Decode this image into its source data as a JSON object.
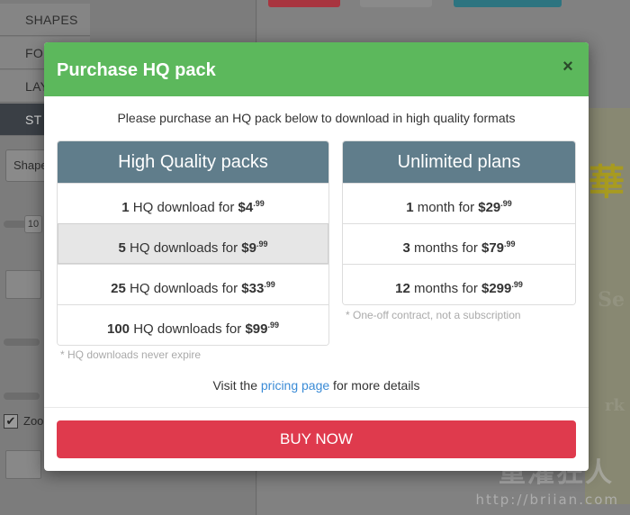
{
  "background": {
    "sidebar_tabs": [
      {
        "label": "SHAPES"
      },
      {
        "label": "FO"
      },
      {
        "label": "LAY"
      },
      {
        "label": "ST"
      }
    ],
    "shape_select": "Shape",
    "slider_value": "10",
    "zoom_label": "Zoo",
    "watermark": "http://briian.com",
    "watermark_cn": "重灌狂人",
    "colors": {
      "top_red": "#a8353f",
      "top_gray": "#8a8a8a",
      "top_teal": "#2d7480"
    }
  },
  "modal": {
    "title": "Purchase HQ pack",
    "close_icon": "×",
    "intro": "Please purchase an HQ pack below to download in high quality formats",
    "colors": {
      "header": "#5cb85c",
      "panel_head": "#607d8b",
      "buy": "#df3a4d",
      "link": "#3a8bd6"
    },
    "hq_packs": {
      "heading": "High Quality packs",
      "options": [
        {
          "qty": "1",
          "text": " HQ download for ",
          "price": "$4",
          "cents": ".99",
          "selected": false
        },
        {
          "qty": "5",
          "text": " HQ downloads for ",
          "price": "$9",
          "cents": ".99",
          "selected": true
        },
        {
          "qty": "25",
          "text": " HQ downloads for ",
          "price": "$33",
          "cents": ".99",
          "selected": false
        },
        {
          "qty": "100",
          "text": " HQ downloads for ",
          "price": "$99",
          "cents": ".99",
          "selected": false
        }
      ],
      "note": "* HQ downloads never expire"
    },
    "unlimited": {
      "heading": "Unlimited plans",
      "options": [
        {
          "qty": "1",
          "text": " month for ",
          "price": "$29",
          "cents": ".99"
        },
        {
          "qty": "3",
          "text": " months for ",
          "price": "$79",
          "cents": ".99"
        },
        {
          "qty": "12",
          "text": " months for ",
          "price": "$299",
          "cents": ".99"
        }
      ],
      "note": "* One-off contract, not a subscription"
    },
    "visit": {
      "before": "Visit the ",
      "link": "pricing page",
      "after": " for more details"
    },
    "buy_label": "BUY NOW"
  }
}
